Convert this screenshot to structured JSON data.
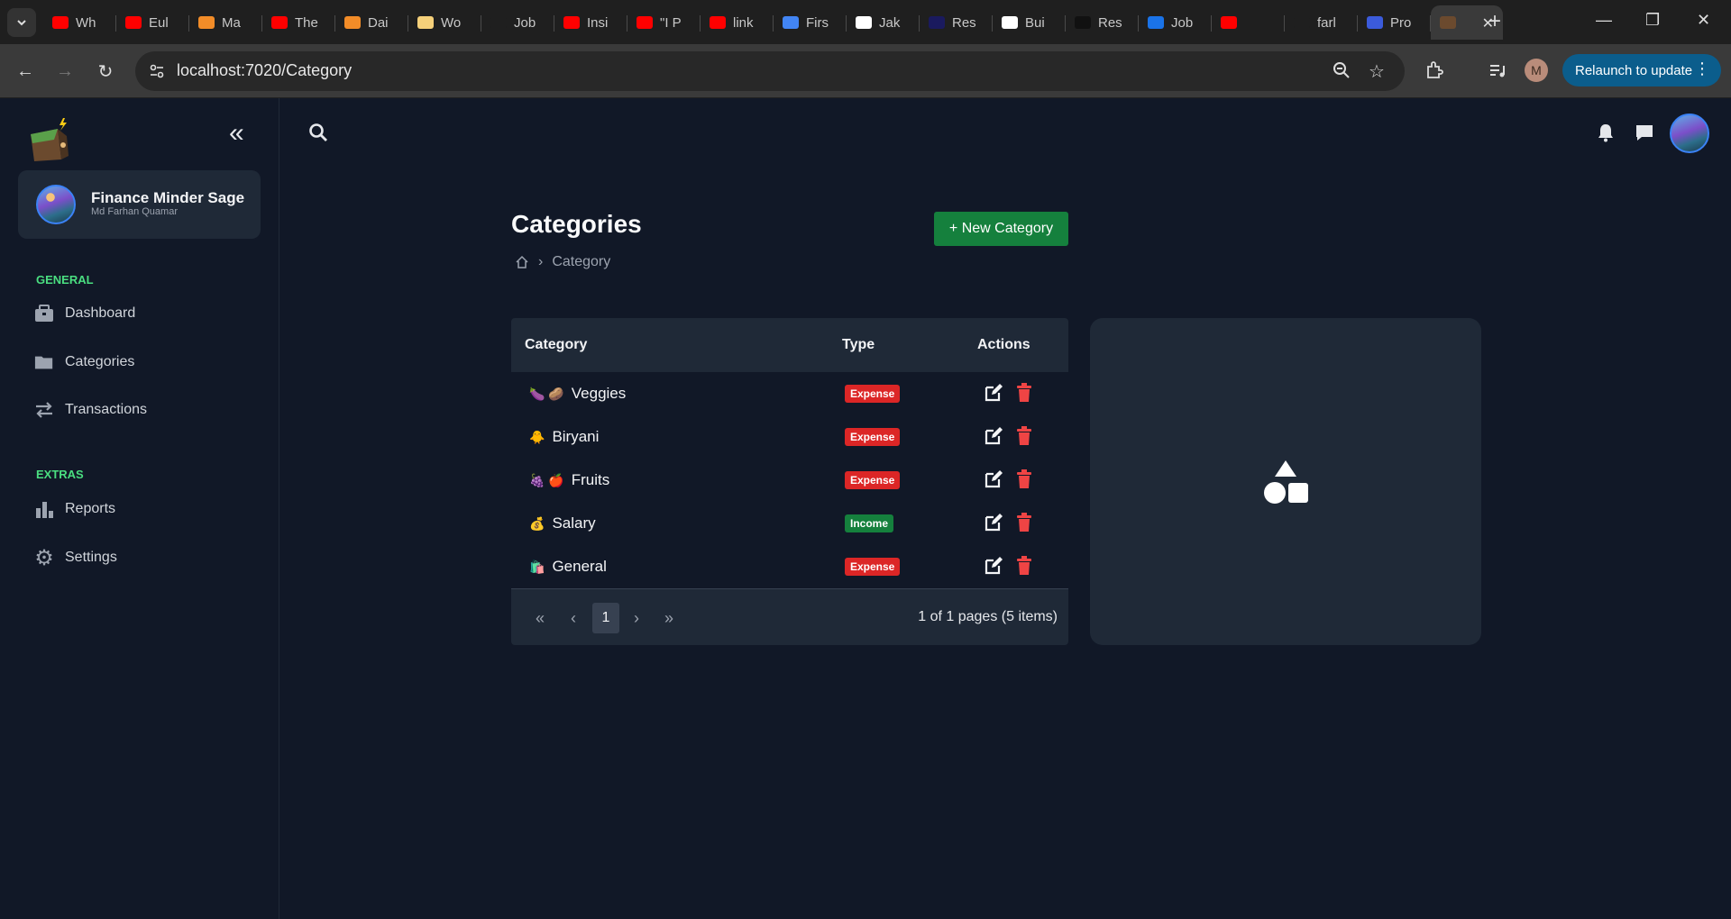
{
  "browser": {
    "tabs": [
      {
        "label": "Wh",
        "fav_color": "#ff0000"
      },
      {
        "label": "Eul",
        "fav_color": "#ff0000"
      },
      {
        "label": "Ma",
        "fav_color": "#f28c28"
      },
      {
        "label": "The",
        "fav_color": "#ff0000"
      },
      {
        "label": "Dai",
        "fav_color": "#f28c28"
      },
      {
        "label": "Wo",
        "fav_color": "#f5d07a"
      },
      {
        "label": "Job",
        "fav_color": "#1f1f1f"
      },
      {
        "label": "Insi",
        "fav_color": "#ff0000"
      },
      {
        "label": "\"I P",
        "fav_color": "#ff0000"
      },
      {
        "label": "link",
        "fav_color": "#ff0000"
      },
      {
        "label": "Firs",
        "fav_color": "#4285f4"
      },
      {
        "label": "Jak",
        "fav_color": "#ffffff"
      },
      {
        "label": "Res",
        "fav_color": "#1a1a5e"
      },
      {
        "label": "Bui",
        "fav_color": "#ffffff"
      },
      {
        "label": "Res",
        "fav_color": "#111111"
      },
      {
        "label": "Job",
        "fav_color": "#1a73e8"
      },
      {
        "label": "",
        "fav_color": "#ff0000"
      },
      {
        "label": "farl",
        "fav_color": "#1f1f1f"
      },
      {
        "label": "Pro",
        "fav_color": "#3b5bdb"
      }
    ],
    "url": "localhost:7020/Category",
    "relaunch_label": "Relaunch to update",
    "profile_initial": "M"
  },
  "app": {
    "profile": {
      "name": "Finance Minder Sage",
      "subtitle": "Md Farhan Quamar"
    },
    "sections": {
      "general": "GENERAL",
      "extras": "EXTRAS"
    },
    "nav": {
      "dashboard": "Dashboard",
      "categories": "Categories",
      "transactions": "Transactions",
      "reports": "Reports",
      "settings": "Settings"
    },
    "page_title": "Categories",
    "breadcrumb_current": "Category",
    "new_button": "+ New Category",
    "table": {
      "headers": {
        "category": "Category",
        "type": "Type",
        "actions": "Actions"
      },
      "rows": [
        {
          "emoji": "🍆 🥔",
          "name": "Veggies",
          "type": "Expense"
        },
        {
          "emoji": "🐥",
          "name": "Biryani",
          "type": "Expense"
        },
        {
          "emoji": "🍇 🍎",
          "name": "Fruits",
          "type": "Expense"
        },
        {
          "emoji": "💰",
          "name": "Salary",
          "type": "Income"
        },
        {
          "emoji": "🛍️",
          "name": "General",
          "type": "Expense"
        }
      ]
    },
    "pager": {
      "current_page": "1",
      "info": "1 of 1 pages (5 items)"
    },
    "colors": {
      "accent_green": "#15803d",
      "expense_red": "#dc2626",
      "section_green": "#4ade80",
      "background": "#111827",
      "card": "#1f2937"
    }
  }
}
